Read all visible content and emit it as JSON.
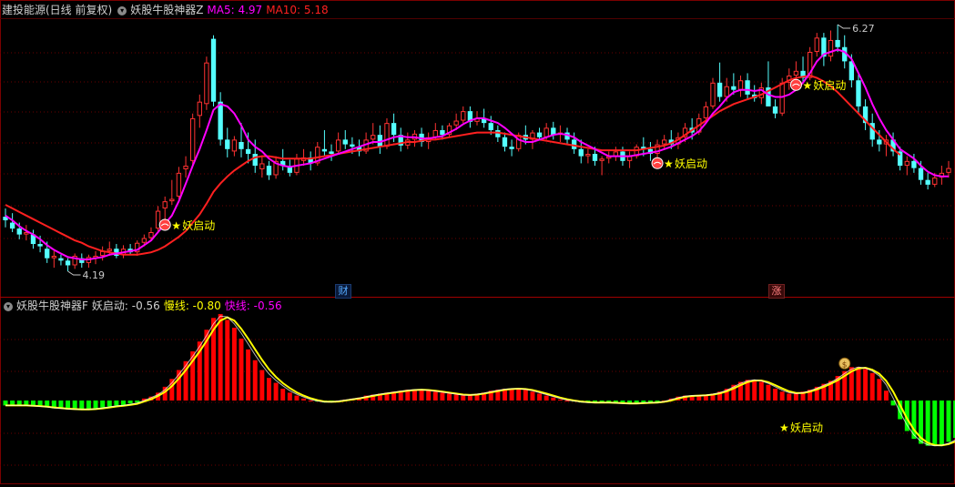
{
  "upper": {
    "stock_label": "建投能源(日线 前复权)",
    "indicator_name": "妖股牛股神器Z",
    "ma5_label": "MA5: 4.97",
    "ma10_label": "MA10: 5.18",
    "colors": {
      "ma5": "#ff00ff",
      "ma10": "#ff2020",
      "up": "#ff3232",
      "down": "#54ffff"
    }
  },
  "lower": {
    "indicator_name": "妖股牛股神器F",
    "yao_label": "妖启动: -0.56",
    "slow_label": "慢线: -0.80",
    "fast_label": "快线: -0.56",
    "colors": {
      "positive": "#ff0000",
      "negative": "#00ff00",
      "slow": "#ffff00",
      "fast": "#ff00ff"
    }
  },
  "markers": {
    "cai": "财",
    "zhang": "涨"
  },
  "chart_data": [
    {
      "type": "candlestick",
      "title": "建投能源(日线 前复权)",
      "annotations": {
        "high": "6.27",
        "low": "4.19",
        "signal_text": "妖启动",
        "signals_at_index": [
          23,
          94,
          114
        ]
      },
      "candles": [
        [
          4.65,
          4.72,
          4.56,
          4.62
        ],
        [
          4.6,
          4.68,
          4.52,
          4.55
        ],
        [
          4.55,
          4.6,
          4.46,
          4.5
        ],
        [
          4.5,
          4.58,
          4.45,
          4.52
        ],
        [
          4.5,
          4.54,
          4.38,
          4.42
        ],
        [
          4.42,
          4.49,
          4.35,
          4.4
        ],
        [
          4.38,
          4.44,
          4.26,
          4.3
        ],
        [
          4.3,
          4.36,
          4.22,
          4.32
        ],
        [
          4.3,
          4.33,
          4.24,
          4.28
        ],
        [
          4.28,
          4.3,
          4.19,
          4.24
        ],
        [
          4.24,
          4.34,
          4.21,
          4.32
        ],
        [
          4.3,
          4.34,
          4.22,
          4.26
        ],
        [
          4.26,
          4.33,
          4.22,
          4.31
        ],
        [
          4.3,
          4.36,
          4.25,
          4.32
        ],
        [
          4.32,
          4.4,
          4.28,
          4.36
        ],
        [
          4.36,
          4.44,
          4.32,
          4.38
        ],
        [
          4.38,
          4.42,
          4.3,
          4.32
        ],
        [
          4.33,
          4.41,
          4.3,
          4.38
        ],
        [
          4.38,
          4.42,
          4.33,
          4.35
        ],
        [
          4.35,
          4.45,
          4.32,
          4.43
        ],
        [
          4.43,
          4.5,
          4.4,
          4.47
        ],
        [
          4.47,
          4.56,
          4.45,
          4.52
        ],
        [
          4.55,
          4.74,
          4.52,
          4.7
        ],
        [
          4.72,
          4.82,
          4.62,
          4.78
        ],
        [
          4.78,
          4.96,
          4.75,
          4.8
        ],
        [
          4.82,
          5.07,
          4.8,
          5.02
        ],
        [
          5.05,
          5.16,
          4.98,
          5.08
        ],
        [
          5.12,
          5.52,
          5.08,
          5.48
        ],
        [
          5.5,
          5.68,
          5.4,
          5.62
        ],
        [
          5.6,
          6.0,
          5.55,
          5.95
        ],
        [
          6.15,
          6.18,
          5.58,
          5.62
        ],
        [
          5.62,
          5.7,
          5.25,
          5.3
        ],
        [
          5.3,
          5.4,
          5.15,
          5.22
        ],
        [
          5.2,
          5.33,
          5.16,
          5.3
        ],
        [
          5.28,
          5.44,
          5.15,
          5.22
        ],
        [
          5.22,
          5.36,
          5.1,
          5.18
        ],
        [
          5.18,
          5.3,
          5.02,
          5.08
        ],
        [
          5.05,
          5.16,
          4.98,
          5.1
        ],
        [
          5.08,
          5.12,
          4.96,
          5.0
        ],
        [
          5.0,
          5.16,
          4.97,
          5.12
        ],
        [
          5.12,
          5.22,
          5.04,
          5.08
        ],
        [
          5.08,
          5.13,
          4.99,
          5.02
        ],
        [
          5.02,
          5.18,
          5.0,
          5.14
        ],
        [
          5.12,
          5.22,
          5.08,
          5.15
        ],
        [
          5.15,
          5.2,
          5.04,
          5.1
        ],
        [
          5.1,
          5.28,
          5.08,
          5.24
        ],
        [
          5.22,
          5.38,
          5.16,
          5.2
        ],
        [
          5.2,
          5.26,
          5.12,
          5.18
        ],
        [
          5.2,
          5.36,
          5.18,
          5.3
        ],
        [
          5.3,
          5.38,
          5.22,
          5.26
        ],
        [
          5.26,
          5.32,
          5.18,
          5.24
        ],
        [
          5.24,
          5.3,
          5.16,
          5.2
        ],
        [
          5.2,
          5.36,
          5.18,
          5.3
        ],
        [
          5.3,
          5.44,
          5.26,
          5.34
        ],
        [
          5.34,
          5.42,
          5.18,
          5.24
        ],
        [
          5.24,
          5.48,
          5.22,
          5.44
        ],
        [
          5.44,
          5.52,
          5.28,
          5.34
        ],
        [
          5.34,
          5.4,
          5.2,
          5.25
        ],
        [
          5.25,
          5.36,
          5.22,
          5.3
        ],
        [
          5.3,
          5.38,
          5.24,
          5.35
        ],
        [
          5.35,
          5.4,
          5.24,
          5.28
        ],
        [
          5.28,
          5.36,
          5.22,
          5.32
        ],
        [
          5.32,
          5.44,
          5.3,
          5.38
        ],
        [
          5.38,
          5.42,
          5.3,
          5.34
        ],
        [
          5.34,
          5.44,
          5.32,
          5.42
        ],
        [
          5.42,
          5.52,
          5.38,
          5.46
        ],
        [
          5.46,
          5.58,
          5.44,
          5.54
        ],
        [
          5.54,
          5.58,
          5.4,
          5.45
        ],
        [
          5.45,
          5.54,
          5.42,
          5.48
        ],
        [
          5.48,
          5.56,
          5.4,
          5.44
        ],
        [
          5.44,
          5.5,
          5.34,
          5.38
        ],
        [
          5.38,
          5.42,
          5.28,
          5.32
        ],
        [
          5.32,
          5.36,
          5.2,
          5.24
        ],
        [
          5.24,
          5.3,
          5.16,
          5.22
        ],
        [
          5.22,
          5.36,
          5.2,
          5.34
        ],
        [
          5.34,
          5.42,
          5.26,
          5.3
        ],
        [
          5.3,
          5.38,
          5.22,
          5.36
        ],
        [
          5.36,
          5.4,
          5.3,
          5.32
        ],
        [
          5.32,
          5.44,
          5.3,
          5.4
        ],
        [
          5.4,
          5.45,
          5.3,
          5.34
        ],
        [
          5.34,
          5.42,
          5.28,
          5.36
        ],
        [
          5.36,
          5.4,
          5.26,
          5.3
        ],
        [
          5.3,
          5.36,
          5.18,
          5.22
        ],
        [
          5.22,
          5.3,
          5.1,
          5.16
        ],
        [
          5.16,
          5.22,
          5.1,
          5.18
        ],
        [
          5.18,
          5.24,
          5.08,
          5.12
        ],
        [
          5.12,
          5.16,
          5.0,
          5.14
        ],
        [
          5.14,
          5.2,
          5.1,
          5.16
        ],
        [
          5.16,
          5.24,
          5.12,
          5.2
        ],
        [
          5.2,
          5.24,
          5.08,
          5.12
        ],
        [
          5.12,
          5.2,
          5.06,
          5.16
        ],
        [
          5.16,
          5.26,
          5.14,
          5.24
        ],
        [
          5.24,
          5.32,
          5.16,
          5.22
        ],
        [
          5.22,
          5.28,
          5.12,
          5.18
        ],
        [
          5.18,
          5.3,
          5.14,
          5.26
        ],
        [
          5.26,
          5.34,
          5.22,
          5.3
        ],
        [
          5.3,
          5.38,
          5.22,
          5.26
        ],
        [
          5.26,
          5.36,
          5.22,
          5.32
        ],
        [
          5.32,
          5.44,
          5.28,
          5.4
        ],
        [
          5.4,
          5.48,
          5.3,
          5.36
        ],
        [
          5.36,
          5.52,
          5.34,
          5.48
        ],
        [
          5.48,
          5.62,
          5.44,
          5.58
        ],
        [
          5.58,
          5.82,
          5.56,
          5.78
        ],
        [
          5.78,
          5.95,
          5.62,
          5.66
        ],
        [
          5.66,
          5.82,
          5.62,
          5.75
        ],
        [
          5.75,
          5.86,
          5.68,
          5.72
        ],
        [
          5.72,
          5.84,
          5.66,
          5.8
        ],
        [
          5.8,
          5.86,
          5.64,
          5.68
        ],
        [
          5.68,
          5.76,
          5.62,
          5.65
        ],
        [
          5.65,
          5.78,
          5.6,
          5.74
        ],
        [
          5.74,
          5.96,
          5.72,
          5.58
        ],
        [
          5.58,
          5.64,
          5.48,
          5.52
        ],
        [
          5.52,
          5.82,
          5.5,
          5.78
        ],
        [
          5.78,
          5.9,
          5.72,
          5.84
        ],
        [
          5.84,
          5.96,
          5.8,
          5.88
        ],
        [
          5.88,
          6.0,
          5.78,
          5.82
        ],
        [
          5.82,
          6.08,
          5.8,
          6.04
        ],
        [
          6.04,
          6.2,
          6.0,
          6.16
        ],
        [
          6.16,
          6.2,
          5.92,
          6.0
        ],
        [
          6.0,
          6.22,
          5.96,
          6.14
        ],
        [
          6.14,
          6.27,
          6.04,
          6.08
        ],
        [
          6.08,
          6.18,
          5.9,
          5.96
        ],
        [
          5.96,
          6.02,
          5.74,
          5.8
        ],
        [
          5.8,
          5.86,
          5.52,
          5.58
        ],
        [
          5.58,
          5.64,
          5.38,
          5.44
        ],
        [
          5.44,
          5.52,
          5.24,
          5.3
        ],
        [
          5.3,
          5.38,
          5.2,
          5.26
        ],
        [
          5.26,
          5.34,
          5.16,
          5.3
        ],
        [
          5.3,
          5.36,
          5.16,
          5.2
        ],
        [
          5.2,
          5.24,
          5.04,
          5.08
        ],
        [
          5.08,
          5.16,
          5.0,
          5.12
        ],
        [
          5.12,
          5.18,
          5.02,
          5.06
        ],
        [
          5.06,
          5.12,
          4.92,
          4.96
        ],
        [
          4.96,
          5.02,
          4.88,
          4.92
        ],
        [
          4.92,
          5.02,
          4.9,
          4.98
        ],
        [
          4.98,
          5.08,
          4.92,
          5.02
        ],
        [
          5.02,
          5.12,
          4.98,
          5.06
        ]
      ],
      "ma5": [
        4.66,
        4.62,
        4.57,
        4.53,
        4.5,
        4.46,
        4.41,
        4.37,
        4.34,
        4.31,
        4.3,
        4.29,
        4.29,
        4.3,
        4.31,
        4.33,
        4.34,
        4.35,
        4.36,
        4.37,
        4.41,
        4.45,
        4.52,
        4.59,
        4.66,
        4.78,
        4.93,
        5.08,
        5.22,
        5.38,
        5.55,
        5.6,
        5.58,
        5.52,
        5.42,
        5.3,
        5.24,
        5.2,
        5.14,
        5.1,
        5.08,
        5.07,
        5.08,
        5.09,
        5.1,
        5.12,
        5.14,
        5.16,
        5.18,
        5.2,
        5.22,
        5.24,
        5.26,
        5.28,
        5.28,
        5.3,
        5.32,
        5.33,
        5.32,
        5.32,
        5.31,
        5.31,
        5.32,
        5.33,
        5.36,
        5.39,
        5.43,
        5.46,
        5.48,
        5.48,
        5.46,
        5.44,
        5.4,
        5.35,
        5.3,
        5.28,
        5.28,
        5.3,
        5.32,
        5.34,
        5.35,
        5.34,
        5.32,
        5.28,
        5.25,
        5.22,
        5.19,
        5.16,
        5.16,
        5.16,
        5.16,
        5.17,
        5.18,
        5.19,
        5.2,
        5.22,
        5.24,
        5.27,
        5.3,
        5.33,
        5.37,
        5.44,
        5.52,
        5.58,
        5.65,
        5.7,
        5.72,
        5.72,
        5.71,
        5.72,
        5.68,
        5.66,
        5.66,
        5.68,
        5.72,
        5.78,
        5.86,
        5.96,
        6.02,
        6.04,
        6.06,
        6.04,
        5.98,
        5.86,
        5.74,
        5.6,
        5.48,
        5.38,
        5.3,
        5.22,
        5.18,
        5.14,
        5.08,
        5.03,
        5.0,
        4.99,
        4.99
      ],
      "ma10": [
        4.75,
        4.72,
        4.69,
        4.66,
        4.63,
        4.6,
        4.57,
        4.54,
        4.51,
        4.48,
        4.45,
        4.43,
        4.4,
        4.38,
        4.36,
        4.35,
        4.34,
        4.33,
        4.33,
        4.33,
        4.34,
        4.35,
        4.37,
        4.4,
        4.44,
        4.48,
        4.53,
        4.6,
        4.67,
        4.76,
        4.86,
        4.93,
        4.99,
        5.04,
        5.08,
        5.12,
        5.15,
        5.16,
        5.16,
        5.15,
        5.14,
        5.14,
        5.14,
        5.14,
        5.14,
        5.15,
        5.16,
        5.17,
        5.18,
        5.19,
        5.2,
        5.21,
        5.22,
        5.23,
        5.24,
        5.25,
        5.26,
        5.27,
        5.28,
        5.28,
        5.29,
        5.3,
        5.3,
        5.31,
        5.32,
        5.33,
        5.34,
        5.35,
        5.36,
        5.36,
        5.36,
        5.36,
        5.35,
        5.34,
        5.33,
        5.32,
        5.31,
        5.3,
        5.29,
        5.28,
        5.27,
        5.26,
        5.25,
        5.24,
        5.23,
        5.22,
        5.21,
        5.21,
        5.21,
        5.21,
        5.21,
        5.21,
        5.22,
        5.23,
        5.24,
        5.25,
        5.27,
        5.3,
        5.34,
        5.38,
        5.42,
        5.46,
        5.5,
        5.54,
        5.57,
        5.6,
        5.62,
        5.64,
        5.66,
        5.68,
        5.71,
        5.74,
        5.77,
        5.8,
        5.82,
        5.83,
        5.84,
        5.82,
        5.79,
        5.75,
        5.7,
        5.64,
        5.58,
        5.52,
        5.46,
        5.4,
        5.34,
        5.28,
        5.22,
        5.17
      ]
    },
    {
      "type": "bar",
      "title": "妖股牛股神器F",
      "annotations": {
        "signal_text": "妖启动"
      },
      "values": [
        -0.05,
        -0.05,
        -0.05,
        -0.05,
        -0.06,
        -0.06,
        -0.07,
        -0.08,
        -0.08,
        -0.09,
        -0.09,
        -0.09,
        -0.09,
        -0.08,
        -0.07,
        -0.06,
        -0.05,
        -0.05,
        -0.03,
        -0.02,
        0.02,
        0.04,
        0.08,
        0.14,
        0.22,
        0.31,
        0.4,
        0.5,
        0.6,
        0.72,
        0.84,
        0.88,
        0.82,
        0.74,
        0.63,
        0.52,
        0.41,
        0.31,
        0.23,
        0.18,
        0.12,
        0.08,
        0.05,
        0.02,
        0.0,
        -0.01,
        -0.02,
        -0.01,
        0.0,
        0.01,
        0.02,
        0.03,
        0.05,
        0.06,
        0.07,
        0.08,
        0.09,
        0.1,
        0.11,
        0.11,
        0.11,
        0.1,
        0.09,
        0.08,
        0.07,
        0.06,
        0.05,
        0.06,
        0.07,
        0.08,
        0.1,
        0.11,
        0.12,
        0.12,
        0.12,
        0.11,
        0.09,
        0.07,
        0.05,
        0.03,
        0.01,
        0.0,
        -0.01,
        -0.02,
        -0.02,
        -0.02,
        -0.02,
        -0.02,
        -0.03,
        -0.03,
        -0.03,
        -0.03,
        -0.02,
        -0.02,
        -0.02,
        0.0,
        0.02,
        0.04,
        0.05,
        0.05,
        0.05,
        0.06,
        0.07,
        0.09,
        0.12,
        0.16,
        0.19,
        0.21,
        0.21,
        0.19,
        0.16,
        0.12,
        0.09,
        0.07,
        0.07,
        0.09,
        0.11,
        0.14,
        0.17,
        0.2,
        0.25,
        0.3,
        0.34,
        0.34,
        0.32,
        0.28,
        0.22,
        0.1,
        -0.05,
        -0.19,
        -0.31,
        -0.39,
        -0.44,
        -0.46,
        -0.46,
        -0.45,
        -0.42,
        -0.38,
        -0.34,
        -0.3,
        -0.24,
        -0.19
      ]
    }
  ]
}
